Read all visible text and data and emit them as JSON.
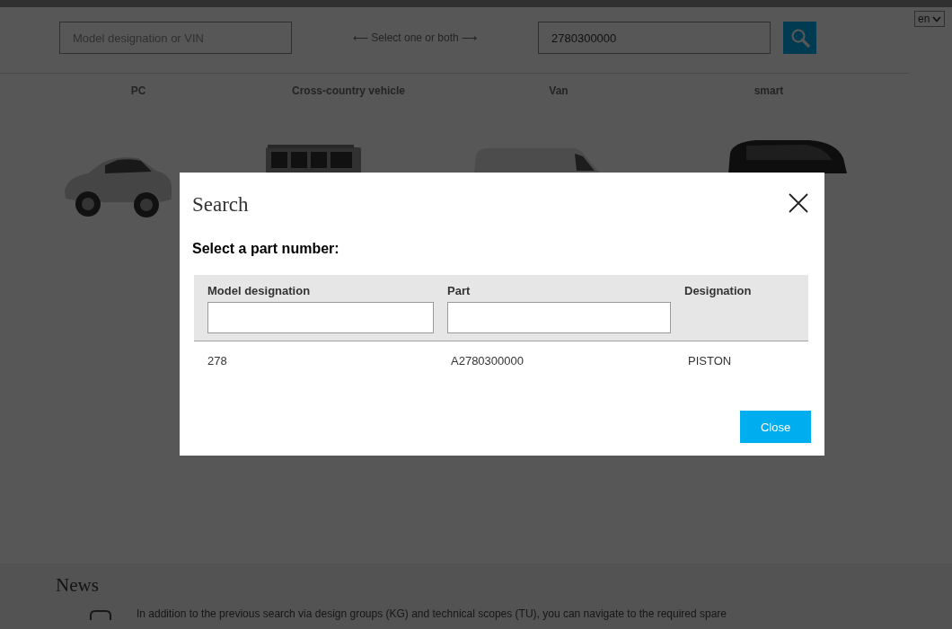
{
  "search_bar": {
    "model_field": {
      "placeholder": "Model designation or VIN"
    },
    "hint": "⟵ Select one or both ⟶",
    "part_field": {
      "value": "2780300000"
    }
  },
  "language_select": {
    "value": "en"
  },
  "vehicle_categories": [
    {
      "label": "PC",
      "kind": "coupe"
    },
    {
      "label": "Cross-country vehicle",
      "kind": "offroad"
    },
    {
      "label": "Van",
      "kind": "van"
    },
    {
      "label": "smart",
      "kind": "microcar"
    }
  ],
  "news": {
    "title": "News",
    "items": [
      {
        "text": "In addition to the previous search via design groups (KG) and technical scopes (TU), you can navigate to the required spare"
      }
    ]
  },
  "dialog": {
    "title": "Search",
    "prompt": "Select a part number:",
    "table": {
      "columns": [
        {
          "label": "Model designation",
          "kind": "filter"
        },
        {
          "label": "Part",
          "kind": "filter"
        },
        {
          "label": "Designation",
          "kind": "plain"
        }
      ],
      "rows": [
        {
          "cells": [
            "278",
            "A2780300000",
            "PISTON"
          ]
        }
      ]
    },
    "buttons": [
      "Close"
    ]
  }
}
